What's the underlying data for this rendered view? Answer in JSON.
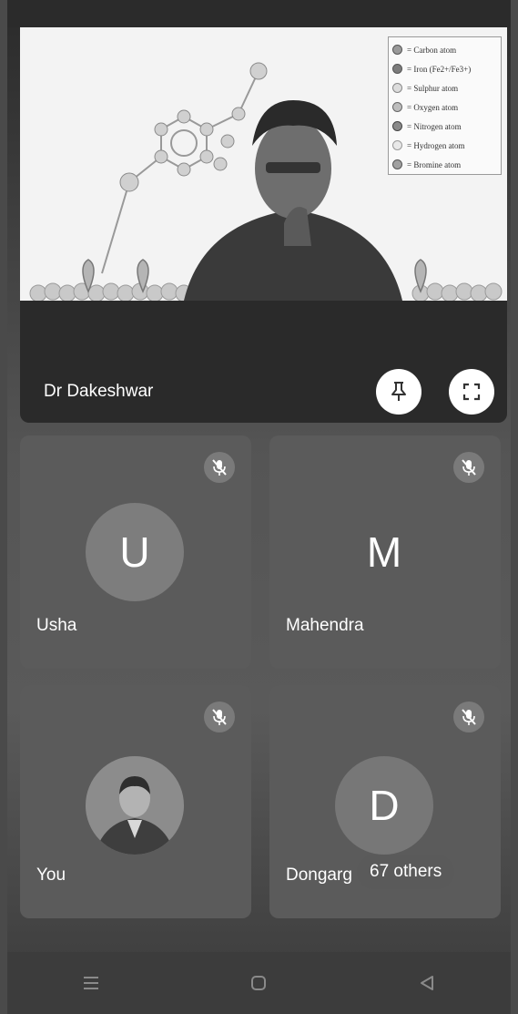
{
  "presenter": {
    "name": "Dr Dakeshwar",
    "legend": [
      {
        "label": "= Carbon atom",
        "color": "#9a9a9a"
      },
      {
        "label": "= Iron (Fe2+/Fe3+)",
        "color": "#7c7c7c"
      },
      {
        "label": "= Sulphur atom",
        "color": "#dcdcdc"
      },
      {
        "label": "= Oxygen atom",
        "color": "#bdbdbd"
      },
      {
        "label": "= Nitrogen atom",
        "color": "#8a8a8a"
      },
      {
        "label": "= Hydrogen atom",
        "color": "#e8e8e8"
      },
      {
        "label": "= Bromine atom",
        "color": "#a0a0a0"
      }
    ],
    "pin_icon": "pin-icon",
    "fullscreen_icon": "fullscreen-icon"
  },
  "participants": [
    {
      "name": "Usha",
      "initial": "U",
      "muted": true
    },
    {
      "name": "Mahendra",
      "initial": "M",
      "muted": true
    },
    {
      "name": "You",
      "initial": "",
      "muted": true
    },
    {
      "name": "Dongarg",
      "initial": "D",
      "muted": true
    }
  ],
  "others_label": "67 others",
  "nav": {
    "menu_icon": "menu-icon",
    "home_icon": "home-icon",
    "back_icon": "back-icon"
  },
  "colors": {
    "muted_badge": "#7a7a7a",
    "avatar_u": "#7d7d7d",
    "avatar_d": "#777777"
  }
}
